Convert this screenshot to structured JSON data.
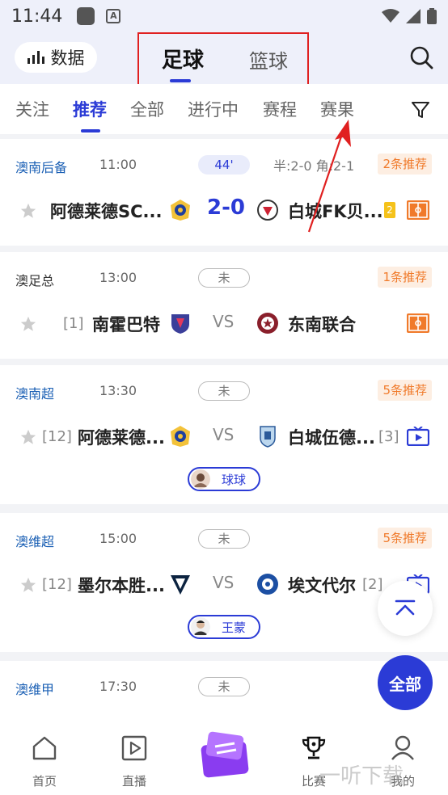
{
  "status_bar": {
    "time": "11:44",
    "app_icon_letter": "A"
  },
  "header": {
    "data_button": "数据",
    "sport_tabs": [
      {
        "label": "足球",
        "active": true
      },
      {
        "label": "篮球",
        "active": false
      }
    ]
  },
  "sub_tabs": [
    {
      "label": "关注",
      "active": false
    },
    {
      "label": "推荐",
      "active": true
    },
    {
      "label": "全部",
      "active": false
    },
    {
      "label": "进行中",
      "active": false
    },
    {
      "label": "赛程",
      "active": false
    },
    {
      "label": "赛果",
      "active": false
    }
  ],
  "matches": [
    {
      "league": "澳南后备",
      "time": "11:00",
      "status": "44'",
      "halftime": "半:2-0 角:2-1",
      "recommend": "2条推荐",
      "home": "阿德莱德SC...",
      "away": "白城FK贝...",
      "score": "2-0",
      "yellow": "2"
    },
    {
      "league": "澳足总",
      "time": "13:00",
      "status": "未",
      "recommend": "1条推荐",
      "home_rank": "[1]",
      "home": "南霍巴特",
      "away": "东南联合",
      "vs": "VS"
    },
    {
      "league": "澳南超",
      "time": "13:30",
      "status": "未",
      "recommend": "5条推荐",
      "home_rank": "[12]",
      "home": "阿德莱德...",
      "away": "白城伍德...",
      "away_rank": "[3]",
      "vs": "VS",
      "expert": "球球"
    },
    {
      "league": "澳维超",
      "time": "15:00",
      "status": "未",
      "recommend": "5条推荐",
      "home_rank": "[12]",
      "home": "墨尔本胜...",
      "away": "埃文代尔",
      "away_rank": "[2]",
      "vs": "VS",
      "expert": "王蒙"
    },
    {
      "league": "澳维甲",
      "time": "17:30",
      "status": "未"
    }
  ],
  "fab": {
    "all": "全部"
  },
  "bottom_nav": [
    {
      "label": "首页",
      "icon": "home-icon"
    },
    {
      "label": "直播",
      "icon": "play-icon"
    },
    {
      "label": "",
      "icon": "center-promo-icon"
    },
    {
      "label": "比赛",
      "icon": "trophy-icon",
      "active": true
    },
    {
      "label": "我的",
      "icon": "user-icon"
    }
  ],
  "watermark": "一听下载",
  "colors": {
    "accent": "#2b3bd6",
    "orange": "#f07a2a",
    "league_blue": "#1a5fb4",
    "league_dark": "#333333",
    "annotation_red": "#e02020"
  }
}
